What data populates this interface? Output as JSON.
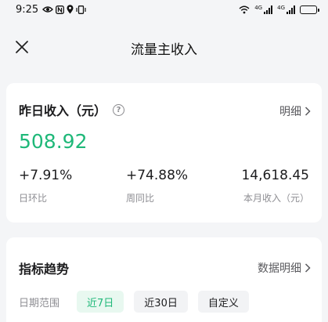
{
  "status_bar": {
    "time": "9:25",
    "left_icons": [
      "eye-icon",
      "nfc-icon",
      "location-icon",
      "vibrate-icon"
    ],
    "right_icons": [
      "wifi-icon",
      "signal-icon",
      "signal-icon",
      "battery-icon"
    ],
    "sig1_label": "4G",
    "sig2_label": "4G"
  },
  "nav": {
    "title": "流量主收入",
    "close_icon": "close-icon"
  },
  "summary": {
    "label": "昨日收入（元）",
    "detail_link": "明细",
    "value": "508.92",
    "value_color": "#1fb879",
    "metrics": [
      {
        "value": "+7.91%",
        "label": "日环比"
      },
      {
        "value": "+74.88%",
        "label": "周同比"
      },
      {
        "value": "14,618.45",
        "label": "本月收入（元）"
      }
    ]
  },
  "trend": {
    "title": "指标趋势",
    "detail_link": "数据明细",
    "range_label": "日期范围",
    "options": [
      {
        "label": "近7日",
        "active": true
      },
      {
        "label": "近30日",
        "active": false
      },
      {
        "label": "自定义",
        "active": false
      }
    ],
    "accent_color": "#1fb879"
  }
}
